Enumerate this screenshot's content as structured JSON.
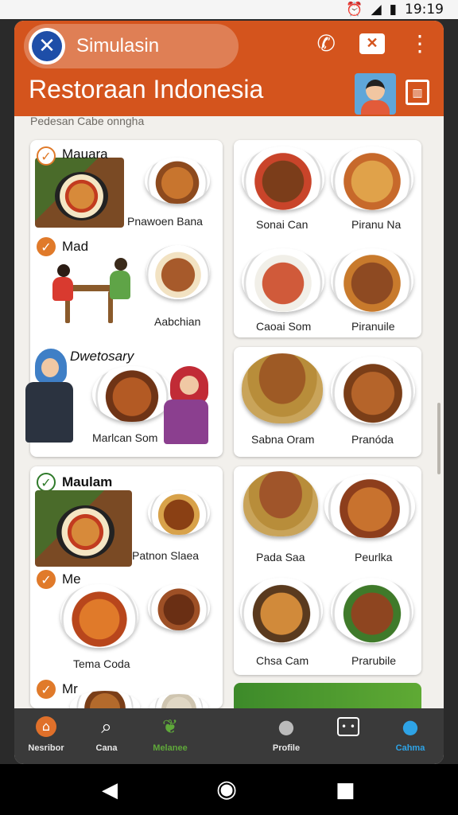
{
  "status_bar": {
    "time": "19:19",
    "icons": [
      "alarm-icon",
      "signal-icon",
      "battery-icon"
    ]
  },
  "app_bar": {
    "app_name": "Simulasin",
    "title": "Restoraan Indonesia",
    "actions": [
      "phone-icon",
      "message-icon",
      "more-icon"
    ],
    "menu_icon_glyph": "▥"
  },
  "subtitle": "Pedesan Cabe onngha",
  "left_cards": [
    {
      "sections": [
        {
          "heading": "Mauara",
          "caption": "Pnawoen Bana"
        },
        {
          "heading": "Mad",
          "caption": "Aabchian"
        },
        {
          "heading": "Dwetosary",
          "caption": "Marlcan Som"
        }
      ]
    },
    {
      "sections": [
        {
          "heading": "Maulam",
          "caption": "Patnon Slaea"
        },
        {
          "heading": "Me",
          "caption": "Tema Coda"
        },
        {
          "heading": "Mr",
          "caption": ""
        }
      ]
    }
  ],
  "right_cards": [
    {
      "items": [
        "Sonai Can",
        "Piranu Na",
        "Caoai Som",
        "Piranuile"
      ]
    },
    {
      "items": [
        "Sabna Oram",
        "Pranóda"
      ]
    },
    {
      "items": [
        "Pada Saa",
        "Peurlka",
        "Chsa Cam",
        "Prarubile"
      ]
    }
  ],
  "bottom_nav": [
    {
      "label": "Nesribor",
      "icon": "home-icon",
      "active": false
    },
    {
      "label": "Cana",
      "icon": "search-icon",
      "active": false
    },
    {
      "label": "Melanee",
      "icon": "leaf-icon",
      "active": false
    },
    {
      "label": "Profile",
      "icon": "person-icon",
      "active": false
    },
    {
      "label": "",
      "icon": "grid-icon",
      "active": false
    },
    {
      "label": "Cahma",
      "icon": "account-icon",
      "active": true
    }
  ],
  "colors": {
    "accent": "#d4541d",
    "nav_bg": "#3a3a3a",
    "active_nav": "#2ea3e6",
    "check": "#e07a2a",
    "melanee_text": "#5fa83a"
  }
}
